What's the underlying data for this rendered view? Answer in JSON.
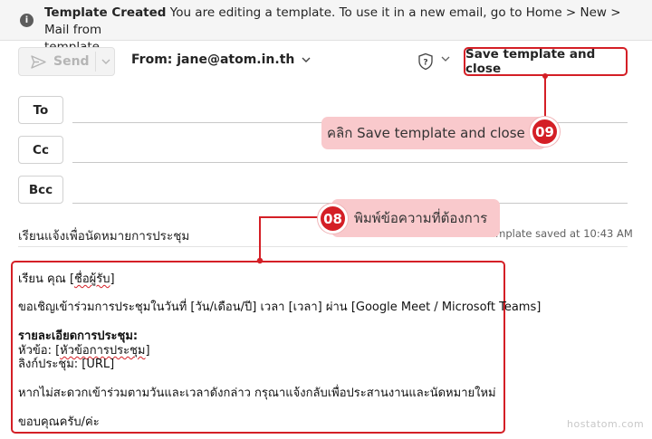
{
  "info_bar": {
    "title": "Template Created",
    "message_line1": " You are editing a template. To use it in a new email, go to Home > New > Mail from",
    "message_line2": "template.",
    "icon": "info-icon"
  },
  "toolbar": {
    "send_label": "Send",
    "from_label": "From: jane@atom.in.th",
    "save_label": "Save template and close"
  },
  "recipients": {
    "to": "To",
    "cc": "Cc",
    "bcc": "Bcc"
  },
  "subject": {
    "value": "เรียนแจ้งเพื่อนัดหมายการประชุม",
    "saved_status": "Template saved at 10:43 AM"
  },
  "body": {
    "greeting_prefix": "เรียน คุณ [",
    "greeting_name": "ชื่อผู้รับ",
    "greeting_suffix": "]",
    "invite": "ขอเชิญเข้าร่วมการประชุมในวันที่ [วัน/เดือน/ปี] เวลา [เวลา] ผ่าน [Google Meet / Microsoft Teams]",
    "details_heading": "รายละเอียดการประชุม:",
    "topic_prefix": "หัวข้อ: [",
    "topic_value": "หัวข้อการประชุม",
    "topic_suffix": "]",
    "link_line": "ลิงก์ประชุม: [URL]",
    "reschedule": "หากไม่สะดวกเข้าร่วมตามวันและเวลาดังกล่าว กรุณาแจ้งกลับเพื่อประสานงานและนัดหมายใหม่",
    "closing": "ขอบคุณครับ/ค่ะ"
  },
  "callouts": {
    "step08": {
      "number": "08",
      "text": "พิมพ์ข้อความที่ต้องการ"
    },
    "step09": {
      "number": "09",
      "text": "คลิก Save template and close"
    }
  },
  "watermark": "hostatom.com",
  "colors": {
    "accent_red": "#d41f26",
    "callout_pink": "#f9c9cc",
    "info_bar_bg": "#f5f5f5"
  }
}
